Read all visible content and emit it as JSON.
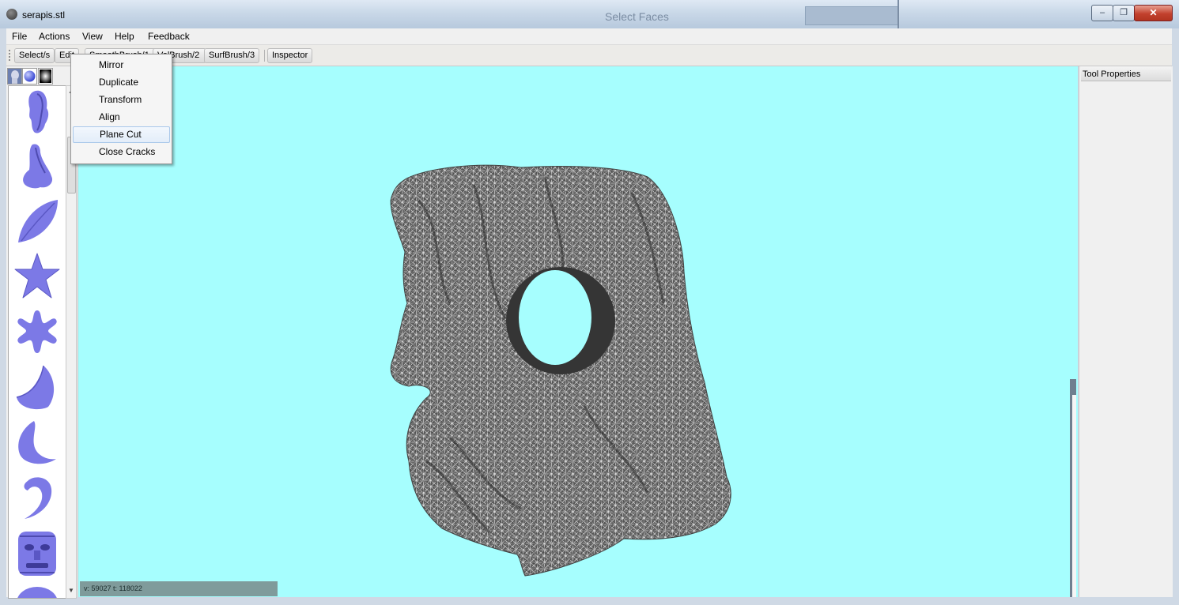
{
  "window": {
    "title": "serapis.stl",
    "background_window_title": "Select Faces",
    "controls": {
      "minimize": "–",
      "maximize": "❐",
      "close": "✕"
    }
  },
  "menubar": {
    "items": [
      {
        "label": "File"
      },
      {
        "label": "Actions"
      },
      {
        "label": "View"
      },
      {
        "label": "Help"
      },
      {
        "label": "Feedback"
      }
    ]
  },
  "toolbar": {
    "buttons": [
      {
        "label": "Select/s"
      },
      {
        "label": "Edit"
      },
      {
        "label": "SmoothBrush/1"
      },
      {
        "label": "VolBrush/2"
      },
      {
        "label": "SurfBrush/3"
      },
      {
        "label": "Inspector"
      }
    ]
  },
  "edit_menu": {
    "items": [
      {
        "label": "Mirror"
      },
      {
        "label": "Duplicate"
      },
      {
        "label": "Transform"
      },
      {
        "label": "Align"
      },
      {
        "label": "Plane Cut",
        "highlighted": true
      },
      {
        "label": "Close Cracks"
      }
    ]
  },
  "left_panel": {
    "tabs": [
      "meshes-tab-icon",
      "spheres-tab-icon",
      "patterns-tab-icon"
    ],
    "shapes": [
      "face-icon",
      "nose-icon",
      "leaf-icon",
      "star-icon",
      "flower-icon",
      "crescent-icon",
      "drop-icon",
      "curl-icon",
      "mask-icon",
      "partial-shape-icon"
    ],
    "shape_color": "#7c79e6"
  },
  "viewport": {
    "background": "#a6fefe",
    "status": "v: 59027 t: 118022",
    "mesh_color": "#4a4a4a"
  },
  "right_panel": {
    "title": "Tool Properties"
  }
}
